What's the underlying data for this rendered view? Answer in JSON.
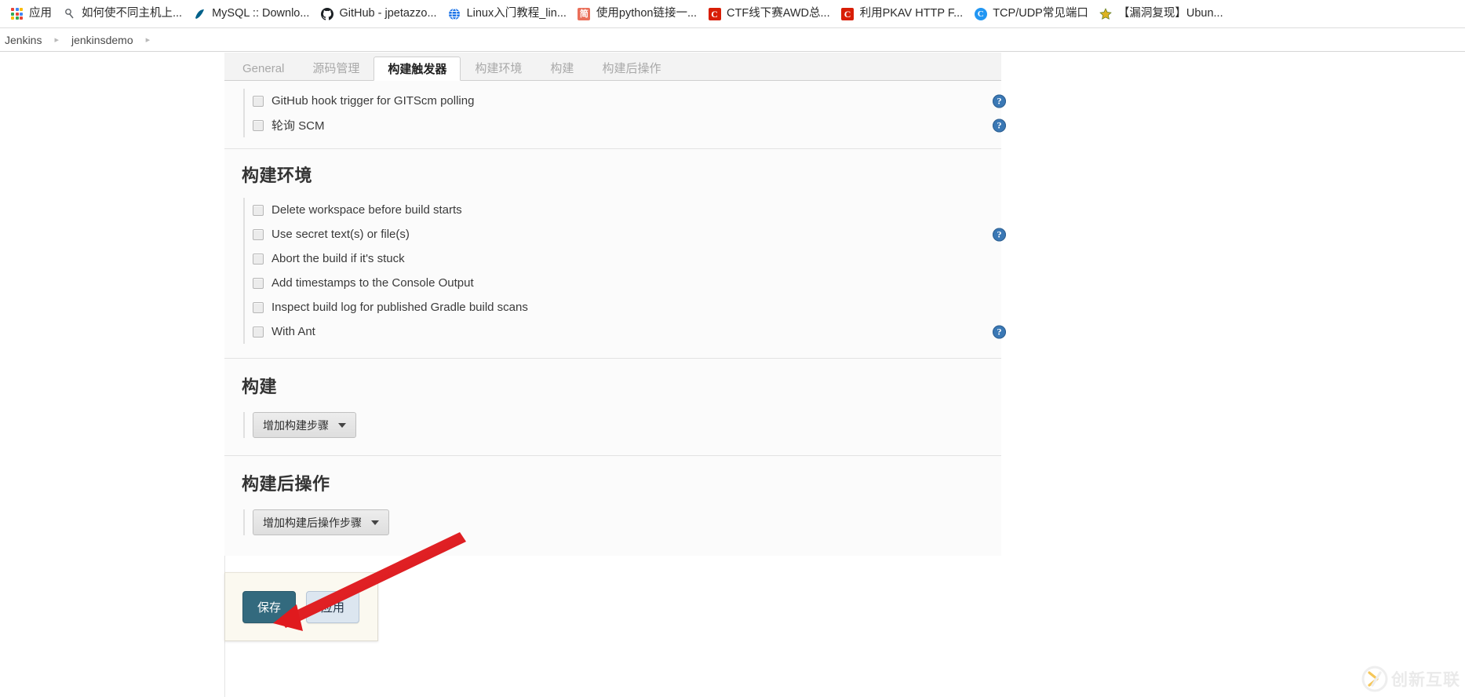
{
  "browser": {
    "bookmarks": [
      {
        "label": "应用",
        "icon": "apps-grid-icon",
        "color": "#4285f4"
      },
      {
        "label": "如何使不同主机上...",
        "icon": "site-icon",
        "color": "#5f6368"
      },
      {
        "label": "MySQL :: Downlo...",
        "icon": "mysql-icon",
        "color": "#00618a"
      },
      {
        "label": "GitHub - jpetazzo...",
        "icon": "github-icon",
        "color": "#24292e"
      },
      {
        "label": "Linux入门教程_lin...",
        "icon": "globe-icon",
        "color": "#1a73e8"
      },
      {
        "label": "使用python链接一...",
        "icon": "jianshu-icon",
        "color": "#ea6f5a"
      },
      {
        "label": "CTF线下赛AWD总...",
        "icon": "csdn-icon",
        "color": "#d81e06"
      },
      {
        "label": "利用PKAV HTTP F...",
        "icon": "csdn-icon",
        "color": "#d81e06"
      },
      {
        "label": "TCP/UDP常见端口",
        "icon": "cnblogs-icon",
        "color": "#2196f3"
      },
      {
        "label": "【漏洞复现】Ubun...",
        "icon": "star-icon",
        "color": "#f5c518"
      }
    ]
  },
  "breadcrumb": {
    "items": [
      "Jenkins",
      "jenkinsdemo"
    ],
    "separator": "▸"
  },
  "config": {
    "tabs": [
      {
        "label": "General",
        "active": false
      },
      {
        "label": "源码管理",
        "active": false
      },
      {
        "label": "构建触发器",
        "active": true
      },
      {
        "label": "构建环境",
        "active": false
      },
      {
        "label": "构建",
        "active": false
      },
      {
        "label": "构建后操作",
        "active": false
      }
    ],
    "triggers": {
      "options": [
        {
          "label": "GitHub hook trigger for GITScm polling",
          "checked": false,
          "help": true
        },
        {
          "label": "轮询 SCM",
          "checked": false,
          "help": true
        }
      ]
    },
    "build_environment": {
      "title": "构建环境",
      "options": [
        {
          "label": "Delete workspace before build starts",
          "checked": false,
          "help": false
        },
        {
          "label": "Use secret text(s) or file(s)",
          "checked": false,
          "help": true
        },
        {
          "label": "Abort the build if it's stuck",
          "checked": false,
          "help": false
        },
        {
          "label": "Add timestamps to the Console Output",
          "checked": false,
          "help": false
        },
        {
          "label": "Inspect build log for published Gradle build scans",
          "checked": false,
          "help": false
        },
        {
          "label": "With Ant",
          "checked": false,
          "help": true
        }
      ]
    },
    "build": {
      "title": "构建",
      "add_step_button": "增加构建步骤"
    },
    "post_build": {
      "title": "构建后操作",
      "add_step_button": "增加构建后操作步骤"
    },
    "actions": {
      "save_label": "保存",
      "apply_label": "应用"
    },
    "help_icon_glyph": "?",
    "colors": {
      "accent": "#336a7e",
      "help_blue": "#3a78b5",
      "annotation_red": "#e8262a",
      "apply_blue": "#dce6f0"
    }
  },
  "watermark": {
    "text": "创新互联"
  }
}
